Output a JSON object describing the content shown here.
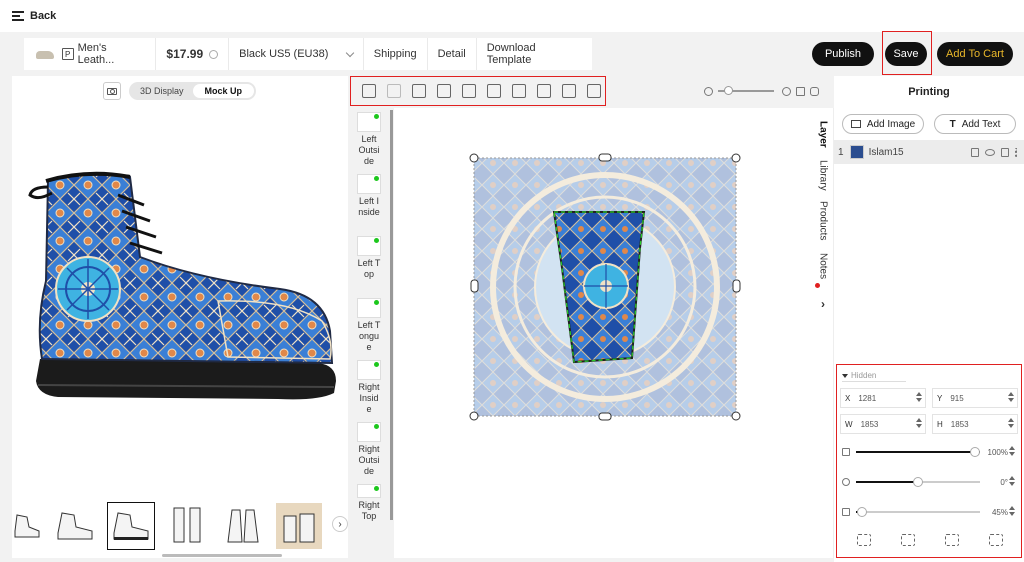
{
  "top": {
    "back_label": "Back"
  },
  "product_bar": {
    "product_badge": "P",
    "product_name": "Men's Leath...",
    "price": "$17.99",
    "variant": "Black US5 (EU38)",
    "links": [
      "Shipping",
      "Detail",
      "Download Template"
    ]
  },
  "actions": {
    "publish": "Publish",
    "save": "Save",
    "add_to_cart": "Add To Cart"
  },
  "mockup": {
    "toggle": [
      "3D Display",
      "Mock Up"
    ],
    "active_toggle": "Mock Up",
    "thumb_prev": "‹",
    "thumb_next": "›"
  },
  "side_list": [
    {
      "label": "Left Outside"
    },
    {
      "label": "Left Inside"
    },
    {
      "label": "Left Top"
    },
    {
      "label": "Left Tongue"
    },
    {
      "label": "Right Inside"
    },
    {
      "label": "Right Outside"
    },
    {
      "label": "Right Top"
    }
  ],
  "right_panel": {
    "title": "Printing",
    "add_image": "Add Image",
    "add_text": "Add Text",
    "tabs": [
      "Layer",
      "Library",
      "Products",
      "Notes"
    ],
    "expand": "›",
    "layer": {
      "index": "1",
      "name": "Islam15"
    }
  },
  "props": {
    "hidden_label": "Hidden",
    "x": {
      "label": "X",
      "value": "1281"
    },
    "y": {
      "label": "Y",
      "value": "915"
    },
    "w": {
      "label": "W",
      "value": "1853"
    },
    "h": {
      "label": "H",
      "value": "1853"
    },
    "opacity": {
      "value": "100%",
      "fraction": 1.0
    },
    "rotation": {
      "value": "0°",
      "fraction": 0.5
    },
    "third": {
      "value": "45%",
      "fraction": 0.05
    }
  },
  "colors": {
    "accent_gold": "#e9b72a",
    "highlight_red": "#e02020",
    "status_green": "#1cc71c"
  }
}
